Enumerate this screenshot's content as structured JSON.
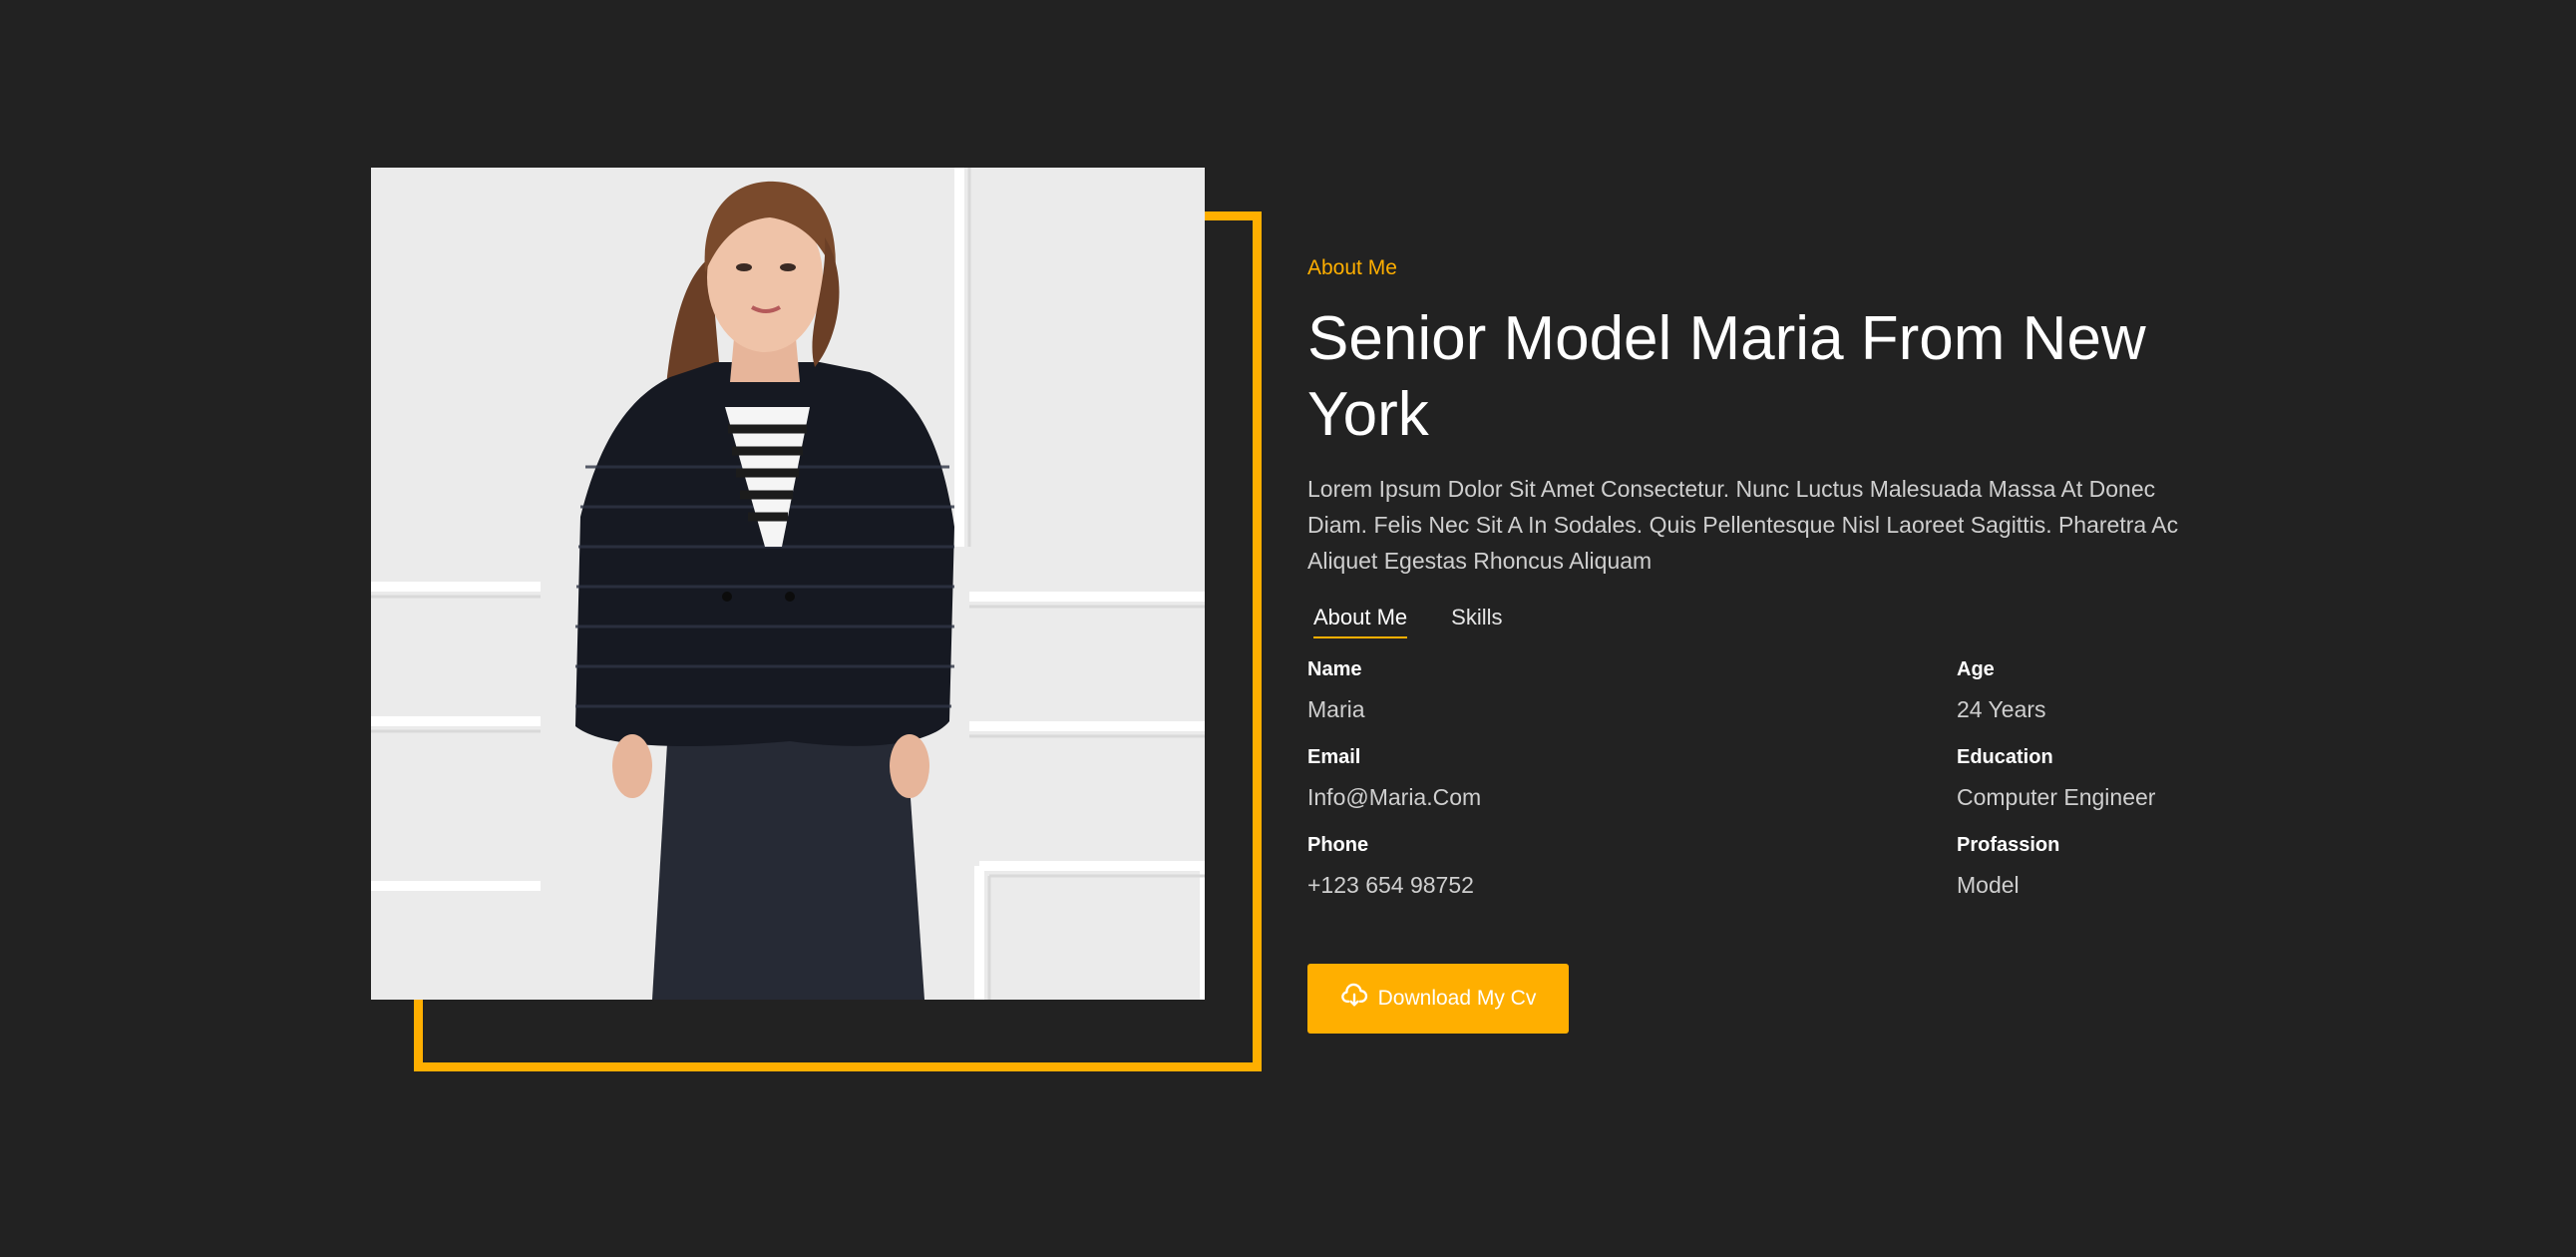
{
  "about": {
    "eyebrow": "About Me",
    "title": "Senior Model Maria From New York",
    "description": "Lorem Ipsum Dolor Sit Amet Consectetur. Nunc Luctus Malesuada Massa At Donec Diam. Felis Nec Sit A In Sodales. Quis Pellentesque Nisl Laoreet Sagittis. Pharetra Ac Aliquet Egestas Rhoncus Aliquam"
  },
  "tabs": [
    {
      "label": "About Me",
      "active": true
    },
    {
      "label": "Skills",
      "active": false
    }
  ],
  "info": [
    {
      "label": "Name",
      "value": "Maria"
    },
    {
      "label": "Age",
      "value": "24 Years"
    },
    {
      "label": "Email",
      "value": "Info@Maria.Com"
    },
    {
      "label": "Education",
      "value": "Computer Engineer"
    },
    {
      "label": "Phone",
      "value": "+123 654 98752"
    },
    {
      "label": "Profassion",
      "value": "Model"
    }
  ],
  "button": {
    "label": "Download My Cv",
    "icon": "cloud-download-icon"
  },
  "colors": {
    "background": "#222222",
    "accent": "#FFAF00",
    "text": "#FFFFFF",
    "muted": "#CFCFCF"
  }
}
